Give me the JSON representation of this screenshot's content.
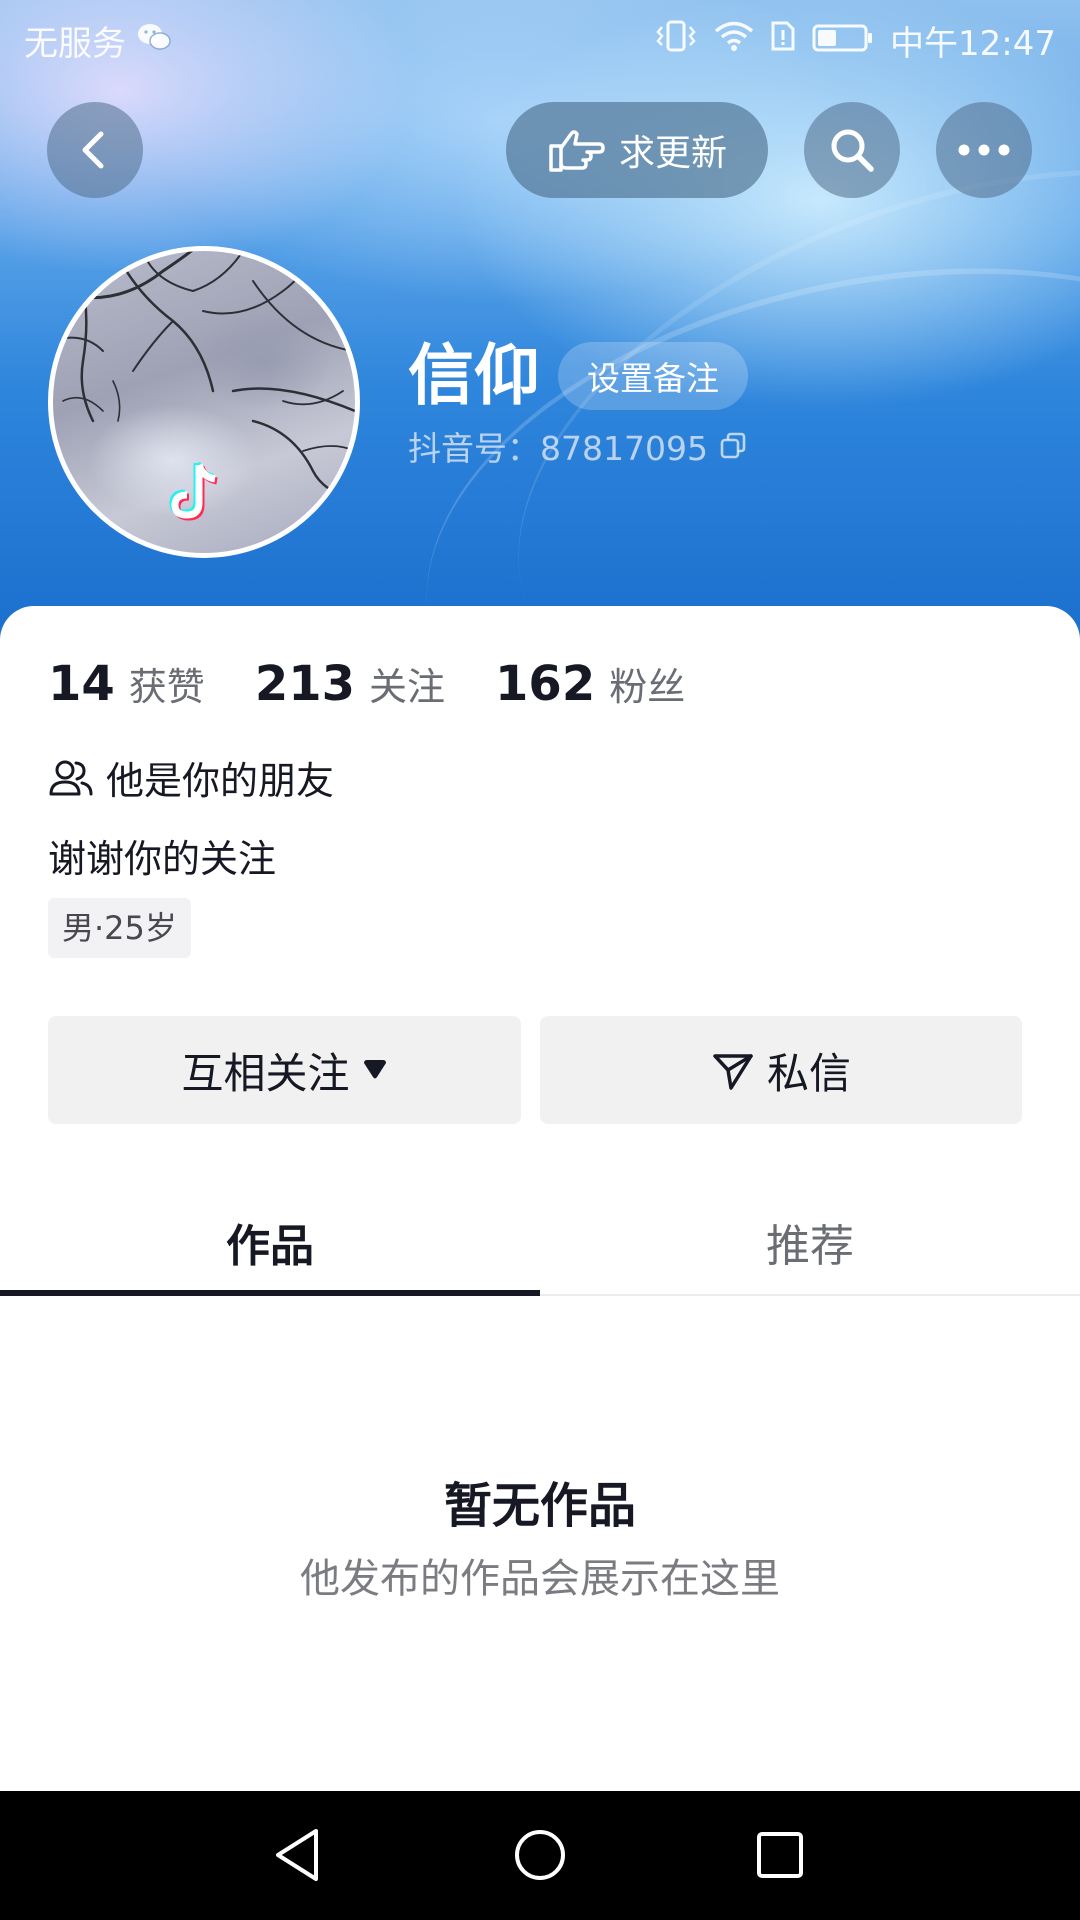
{
  "status_bar": {
    "carrier": "无服务",
    "time": "中午12:47",
    "icons": [
      "wechat-icon",
      "vibrate-icon",
      "wifi-icon",
      "sim-alert-icon",
      "battery-icon"
    ]
  },
  "header": {
    "request_update_label": "求更新",
    "icons": [
      "back-icon",
      "pointing-hand-icon",
      "search-icon",
      "more-icon"
    ]
  },
  "profile": {
    "name": "信仰",
    "remark_label": "设置备注",
    "douyin_id": "抖音号：87817095",
    "avatar_badge": "tiktok-logo-icon"
  },
  "stats": [
    {
      "value": "14",
      "label": "获赞"
    },
    {
      "value": "213",
      "label": "关注"
    },
    {
      "value": "162",
      "label": "粉丝"
    }
  ],
  "relation_text": "他是你的朋友",
  "bio": "谢谢你的关注",
  "tag": "男·25岁",
  "actions": {
    "mutual_follow_label": "互相关注",
    "message_label": "私信"
  },
  "tabs": [
    {
      "label": "作品",
      "active": true
    },
    {
      "label": "推荐",
      "active": false
    }
  ],
  "empty_state": {
    "title": "暂无作品",
    "subtitle": "他发布的作品会展示在这里"
  },
  "nav_bar": {
    "icons": [
      "nav-back-icon",
      "nav-home-icon",
      "nav-recents-icon"
    ]
  },
  "colors": {
    "hero_blue": "#2f86dc",
    "text_primary": "#161823",
    "text_secondary": "#6b6d74",
    "button_bg": "#f1f1f2"
  }
}
